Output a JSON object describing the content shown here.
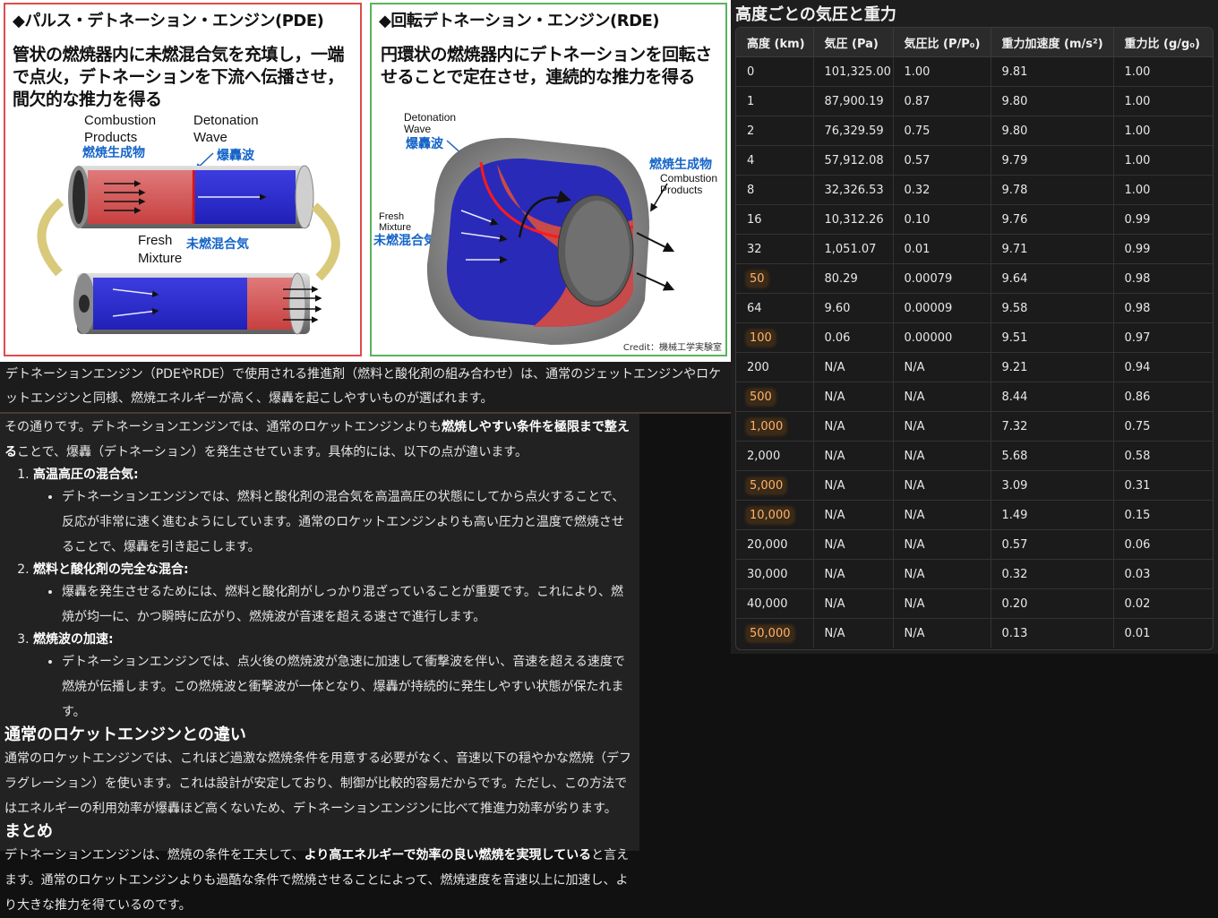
{
  "figure": {
    "pde": {
      "title": "◆パルス・デトネーション・エンジン(PDE)",
      "description": "管状の燃焼器内に未燃混合気を充填し，一端で点火，デトネーションを下流へ伝播させ，間欠的な推力を得る",
      "label_combustion_en": "Combustion",
      "label_products_en": "Products",
      "label_products_ja": "燃焼生成物",
      "label_detonation_en": "Detonation",
      "label_wave_en": "Wave",
      "label_wave_ja": "爆轟波",
      "label_fresh_en": "Fresh",
      "label_mixture_en": "Mixture",
      "label_fresh_ja": "未燃混合気"
    },
    "rde": {
      "title": "◆回転デトネーション・エンジン(RDE)",
      "description": "円環状の燃焼器内にデトネーションを回転させることで定在させ，連続的な推力を得る",
      "label_detonation_en": "Detonation",
      "label_wave_en": "Wave",
      "label_wave_ja": "爆轟波",
      "label_products_ja": "燃焼生成物",
      "label_combustion_en": "Combustion",
      "label_products_en": "Products",
      "label_fresh_en": "Fresh",
      "label_mixture_en": "Mixture",
      "label_fresh_ja": "未燃混合気",
      "credit": "Credit：機械工学実験室"
    }
  },
  "caption": "デトネーションエンジン（PDEやRDE）で使用される推進剤（燃料と酸化剤の組み合わせ）は、通常のジェットエンジンやロケットエンジンと同様、燃焼エネルギーが高く、爆轟を起こしやすいものが選ばれます。",
  "answer": {
    "intro_before": "その通りです。デトネーションエンジンでは、通常のロケットエンジンよりも",
    "intro_bold": "燃焼しやすい条件を極限まで整える",
    "intro_after": "ことで、爆轟（デトネーション）を発生させています。具体的には、以下の点が違います。",
    "items": [
      {
        "title": "高温高圧の混合気",
        "bullet": "デトネーションエンジンでは、燃料と酸化剤の混合気を高温高圧の状態にしてから点火することで、反応が非常に速く進むようにしています。通常のロケットエンジンよりも高い圧力と温度で燃焼させることで、爆轟を引き起こします。"
      },
      {
        "title": "燃料と酸化剤の完全な混合",
        "bullet": "爆轟を発生させるためには、燃料と酸化剤がしっかり混ざっていることが重要です。これにより、燃焼が均一に、かつ瞬時に広がり、燃焼波が音速を超える速さで進行します。"
      },
      {
        "title": "燃焼波の加速",
        "bullet": "デトネーションエンジンでは、点火後の燃焼波が急速に加速して衝撃波を伴い、音速を超える速度で燃焼が伝播します。この燃焼波と衝撃波が一体となり、爆轟が持続的に発生しやすい状態が保たれます。"
      }
    ],
    "heading_diff": "通常のロケットエンジンとの違い",
    "diff_text": "通常のロケットエンジンでは、これほど過激な燃焼条件を用意する必要がなく、音速以下の穏やかな燃焼（デフラグレーション）を使います。これは設計が安定しており、制御が比較的容易だからです。ただし、この方法ではエネルギーの利用効率が爆轟ほど高くないため、デトネーションエンジンに比べて推進力効率が劣ります。",
    "heading_summary": "まとめ",
    "summary_before": "デトネーションエンジンは、燃焼の条件を工夫して、",
    "summary_bold": "より高エネルギーで効率の良い燃焼を実現している",
    "summary_after": "と言えます。通常のロケットエンジンよりも過酷な条件で燃焼させることによって、燃焼速度を音速以上に加速し、より大きな推力を得ているのです。"
  },
  "table": {
    "title": "高度ごとの気圧と重力",
    "headers": [
      "高度 (km)",
      "気圧 (Pa)",
      "気圧比 (P/P₀)",
      "重力加速度 (m/s²)",
      "重力比 (g/g₀)"
    ],
    "highlight_color": "#ffb36b",
    "rows": [
      {
        "alt": "0",
        "hl": false,
        "pa": "101,325.00",
        "pr": "1.00",
        "g": "9.81",
        "gr": "1.00"
      },
      {
        "alt": "1",
        "hl": false,
        "pa": "87,900.19",
        "pr": "0.87",
        "g": "9.80",
        "gr": "1.00"
      },
      {
        "alt": "2",
        "hl": false,
        "pa": "76,329.59",
        "pr": "0.75",
        "g": "9.80",
        "gr": "1.00"
      },
      {
        "alt": "4",
        "hl": false,
        "pa": "57,912.08",
        "pr": "0.57",
        "g": "9.79",
        "gr": "1.00"
      },
      {
        "alt": "8",
        "hl": false,
        "pa": "32,326.53",
        "pr": "0.32",
        "g": "9.78",
        "gr": "1.00"
      },
      {
        "alt": "16",
        "hl": false,
        "pa": "10,312.26",
        "pr": "0.10",
        "g": "9.76",
        "gr": "0.99"
      },
      {
        "alt": "32",
        "hl": false,
        "pa": "1,051.07",
        "pr": "0.01",
        "g": "9.71",
        "gr": "0.99"
      },
      {
        "alt": "50",
        "hl": true,
        "pa": "80.29",
        "pr": "0.00079",
        "g": "9.64",
        "gr": "0.98"
      },
      {
        "alt": "64",
        "hl": false,
        "pa": "9.60",
        "pr": "0.00009",
        "g": "9.58",
        "gr": "0.98"
      },
      {
        "alt": "100",
        "hl": true,
        "pa": "0.06",
        "pr": "0.00000",
        "g": "9.51",
        "gr": "0.97"
      },
      {
        "alt": "200",
        "hl": false,
        "pa": "N/A",
        "pr": "N/A",
        "g": "9.21",
        "gr": "0.94"
      },
      {
        "alt": "500",
        "hl": true,
        "pa": "N/A",
        "pr": "N/A",
        "g": "8.44",
        "gr": "0.86"
      },
      {
        "alt": "1,000",
        "hl": true,
        "pa": "N/A",
        "pr": "N/A",
        "g": "7.32",
        "gr": "0.75"
      },
      {
        "alt": "2,000",
        "hl": false,
        "pa": "N/A",
        "pr": "N/A",
        "g": "5.68",
        "gr": "0.58"
      },
      {
        "alt": "5,000",
        "hl": true,
        "pa": "N/A",
        "pr": "N/A",
        "g": "3.09",
        "gr": "0.31"
      },
      {
        "alt": "10,000",
        "hl": true,
        "pa": "N/A",
        "pr": "N/A",
        "g": "1.49",
        "gr": "0.15"
      },
      {
        "alt": "20,000",
        "hl": false,
        "pa": "N/A",
        "pr": "N/A",
        "g": "0.57",
        "gr": "0.06"
      },
      {
        "alt": "30,000",
        "hl": false,
        "pa": "N/A",
        "pr": "N/A",
        "g": "0.32",
        "gr": "0.03"
      },
      {
        "alt": "40,000",
        "hl": false,
        "pa": "N/A",
        "pr": "N/A",
        "g": "0.20",
        "gr": "0.02"
      },
      {
        "alt": "50,000",
        "hl": true,
        "pa": "N/A",
        "pr": "N/A",
        "g": "0.13",
        "gr": "0.01"
      }
    ]
  }
}
